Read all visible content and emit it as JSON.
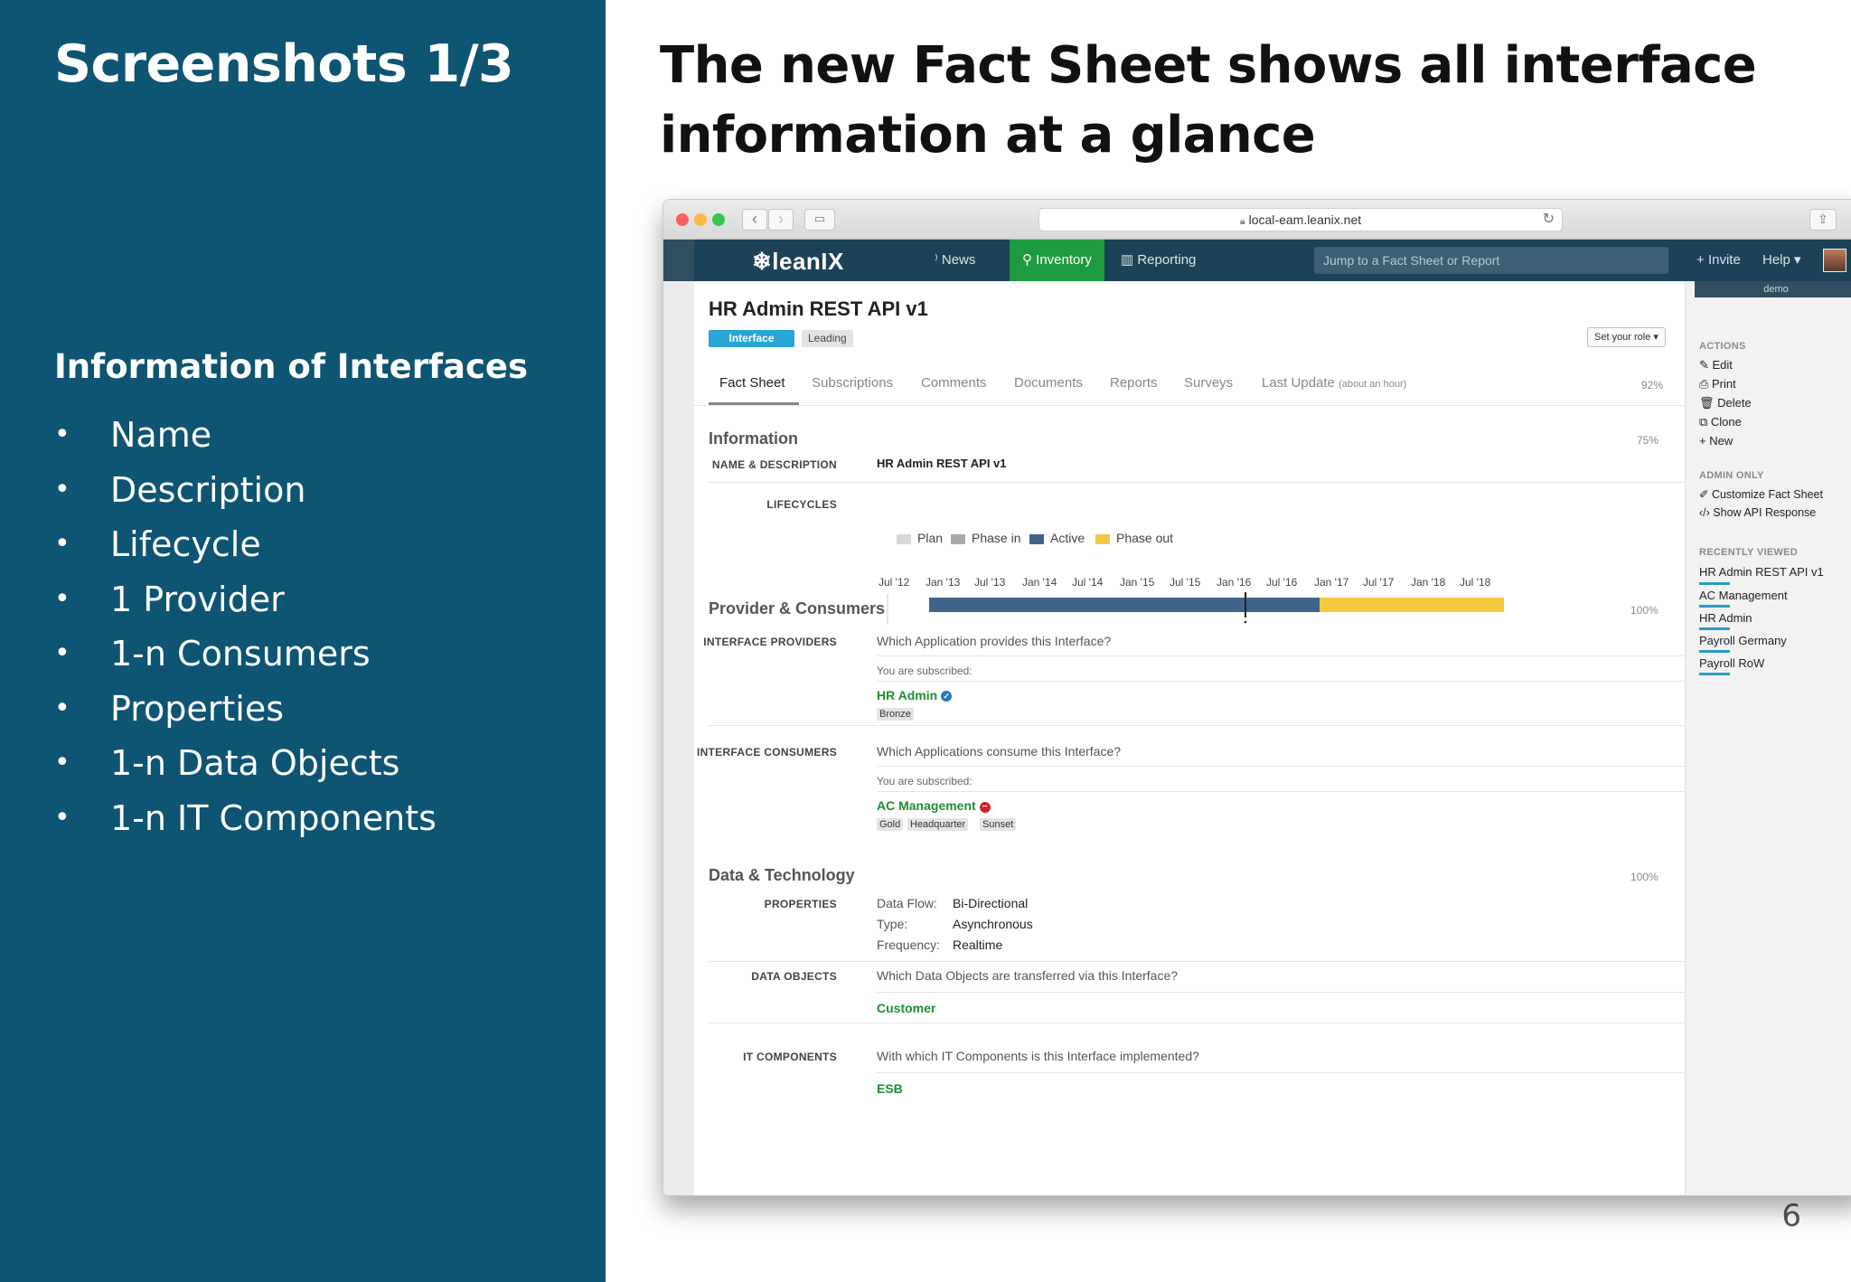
{
  "slide": {
    "left_title": "Screenshots 1/3",
    "subhead": "Information of Interfaces",
    "bullets": [
      "Name",
      "Description",
      "Lifecycle",
      "1 Provider",
      "1-n Consumers",
      "Properties",
      "1-n Data Objects",
      "1-n IT Components"
    ],
    "bullet_symbol": "•",
    "main_title": "The new Fact Sheet shows all interface information at a glance",
    "page_number": "6",
    "panel_color": "#0e5473"
  },
  "browser": {
    "url": "local-eam.leanix.net",
    "lock_icon": "lock-icon",
    "reload_icon": "reload-icon"
  },
  "appnav": {
    "logo": "❄leanIX",
    "news": "News",
    "inventory": "Inventory",
    "reporting": "Reporting",
    "search_placeholder": "Jump to a Fact Sheet or Report",
    "invite": "Invite",
    "help": "Help",
    "active_color": "#1f9b3f"
  },
  "factsheet": {
    "title": "HR Admin REST API v1",
    "type_badge": "Interface",
    "leading_badge": "Leading",
    "role_button": "Set your role ▾",
    "tabs": {
      "fact_sheet": "Fact Sheet",
      "subscriptions": "Subscriptions",
      "comments": "Comments",
      "documents": "Documents",
      "reports": "Reports",
      "surveys": "Surveys",
      "last_update": "Last Update",
      "last_update_note": "(about an hour)"
    },
    "completion": "92%",
    "information": {
      "title": "Information",
      "completion": "75%",
      "name_label": "NAME & DESCRIPTION",
      "name_value": "HR Admin REST API v1",
      "lifecycle_label": "LIFECYCLES",
      "legend": [
        "Plan",
        "Phase in",
        "Active",
        "Phase out"
      ],
      "legend_colors": [
        "#d8d8d8",
        "#a9a9a9",
        "#3e6589",
        "#f5c842"
      ],
      "ticks": [
        "Jul '12",
        "Jan '13",
        "Jul '13",
        "Jan '14",
        "Jul '14",
        "Jan '15",
        "Jul '15",
        "Jan '16",
        "Jul '16",
        "Jan '17",
        "Jul '17",
        "Jan '18",
        "Jul '18"
      ],
      "lifecycle_phases": [
        {
          "phase": "Active",
          "from": "Dec 2012",
          "to": "Jun 2016"
        },
        {
          "phase": "Phase out",
          "from": "Jun 2016",
          "to": "Sep 2018"
        }
      ],
      "today_marker": "Jan 2016"
    },
    "provider_consumers": {
      "title": "Provider & Consumers",
      "completion": "100%",
      "providers_label": "INTERFACE PROVIDERS",
      "providers_question": "Which Application provides this Interface?",
      "providers_subscribed": "You are subscribed:",
      "provider_name": "HR Admin",
      "provider_tags": [
        "Bronze"
      ],
      "consumers_label": "INTERFACE CONSUMERS",
      "consumers_question": "Which Applications consume this Interface?",
      "consumers_subscribed": "You are subscribed:",
      "consumer_name": "AC Management",
      "consumer_tags": [
        "Gold",
        "Headquarter",
        "Sunset"
      ]
    },
    "data_tech": {
      "title": "Data & Technology",
      "completion": "100%",
      "properties_label": "PROPERTIES",
      "properties": [
        {
          "key": "Data Flow:",
          "value": "Bi-Directional"
        },
        {
          "key": "Type:",
          "value": "Asynchronous"
        },
        {
          "key": "Frequency:",
          "value": "Realtime"
        }
      ],
      "data_objects_label": "DATA OBJECTS",
      "data_objects_question": "Which Data Objects are transferred via this Interface?",
      "data_object": "Customer",
      "it_components_label": "IT COMPONENTS",
      "it_components_question": "With which IT Components is this Interface implemented?",
      "it_component": "ESB"
    }
  },
  "sidebar": {
    "demo": "demo",
    "actions_title": "ACTIONS",
    "actions": [
      "Edit",
      "Print",
      "Delete",
      "Clone",
      "New"
    ],
    "admin_title": "ADMIN ONLY",
    "admin": [
      "Customize Fact Sheet",
      "Show API Response"
    ],
    "recent_title": "RECENTLY VIEWED",
    "recent": [
      "HR Admin REST API v1",
      "AC Management",
      "HR Admin",
      "Payroll Germany",
      "Payroll RoW"
    ]
  }
}
